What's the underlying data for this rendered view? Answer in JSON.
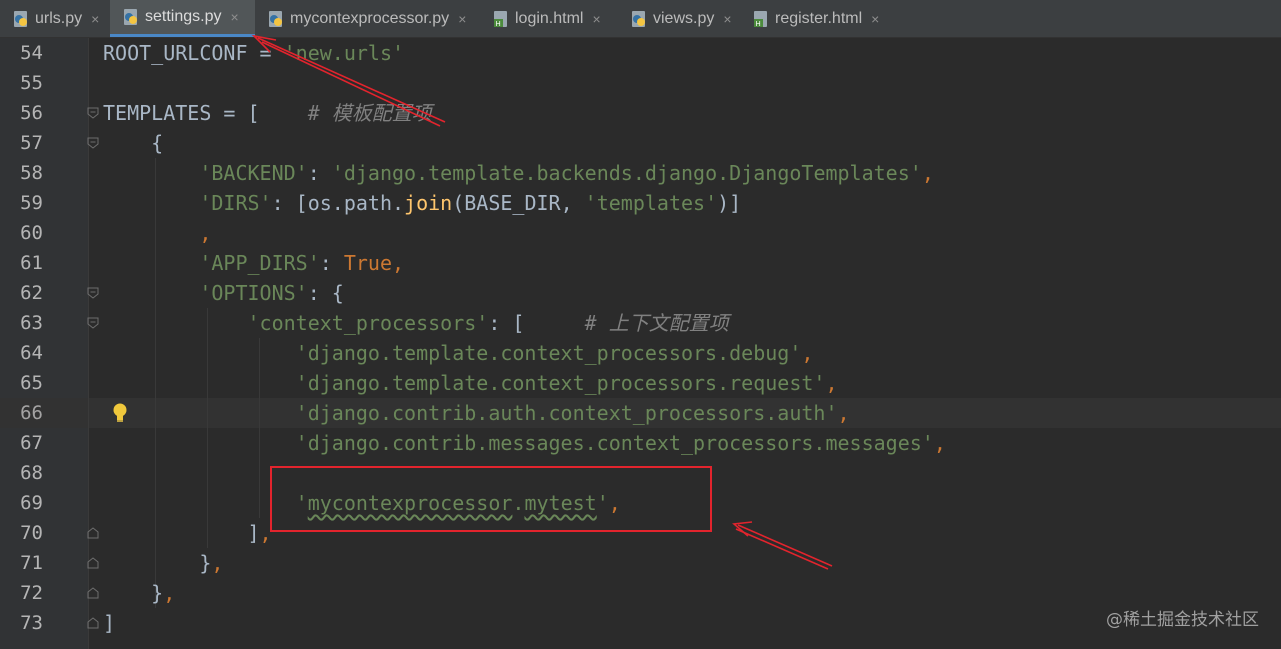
{
  "tabs": [
    {
      "label": "urls.py",
      "icon": "python-file-icon",
      "active": false
    },
    {
      "label": "settings.py",
      "icon": "python-file-icon",
      "active": true
    },
    {
      "label": "mycontexprocessor.py",
      "icon": "python-file-icon",
      "active": false
    },
    {
      "label": "login.html",
      "icon": "html-file-icon",
      "active": false
    },
    {
      "label": "views.py",
      "icon": "python-file-icon",
      "active": false
    },
    {
      "label": "register.html",
      "icon": "html-file-icon",
      "active": false
    }
  ],
  "close_glyph": "×",
  "editor": {
    "current_line": "66",
    "lines": [
      {
        "no": "54",
        "text": "ROOT_URLCONF = 'new.urls'"
      },
      {
        "no": "55",
        "text": ""
      },
      {
        "no": "56",
        "text": "TEMPLATES = [    # 模板配置项"
      },
      {
        "no": "57",
        "text": "    {"
      },
      {
        "no": "58",
        "text": "        'BACKEND': 'django.template.backends.django.DjangoTemplates',"
      },
      {
        "no": "59",
        "text": "        'DIRS': [os.path.join(BASE_DIR, 'templates')]"
      },
      {
        "no": "60",
        "text": "        ,"
      },
      {
        "no": "61",
        "text": "        'APP_DIRS': True,"
      },
      {
        "no": "62",
        "text": "        'OPTIONS': {"
      },
      {
        "no": "63",
        "text": "            'context_processors': [     # 上下文配置项"
      },
      {
        "no": "64",
        "text": "                'django.template.context_processors.debug',"
      },
      {
        "no": "65",
        "text": "                'django.template.context_processors.request',"
      },
      {
        "no": "66",
        "text": "                'django.contrib.auth.context_processors.auth',"
      },
      {
        "no": "67",
        "text": "                'django.contrib.messages.context_processors.messages',"
      },
      {
        "no": "68",
        "text": ""
      },
      {
        "no": "69",
        "text": "                'mycontexprocessor.mytest',"
      },
      {
        "no": "70",
        "text": "            ],"
      },
      {
        "no": "71",
        "text": "        },"
      },
      {
        "no": "72",
        "text": "    },"
      },
      {
        "no": "73",
        "text": "]"
      }
    ]
  },
  "colors": {
    "background": "#2b2b2b",
    "gutter": "#313335",
    "string": "#6a8759",
    "keyword": "#cc7832",
    "function": "#ffc66d",
    "comment": "#808080",
    "annotation_red": "#e2242d"
  },
  "watermark": "@稀土掘金技术社区"
}
